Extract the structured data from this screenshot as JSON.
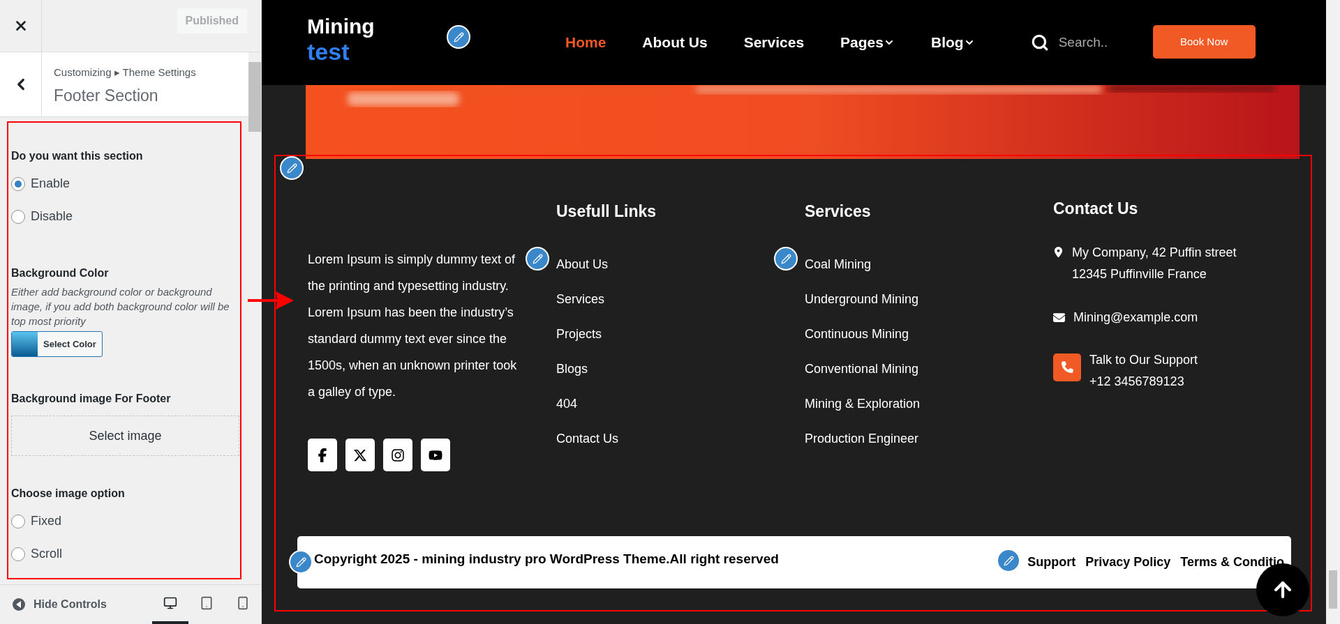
{
  "customizer": {
    "publish_button": "Published",
    "breadcrumb": "Customizing ▸ Theme Settings",
    "section_title": "Footer Section",
    "controls": [
      {
        "kind": "radio-group",
        "label": "Do you want this section",
        "options": [
          {
            "label": "Enable",
            "selected": true
          },
          {
            "label": "Disable",
            "selected": false
          }
        ]
      },
      {
        "kind": "color",
        "label": "Background Color",
        "description": "Either add background color or background image, if you add both background color will be top most priority",
        "button": "Select Color"
      },
      {
        "label": "Background image For Footer",
        "button": "Select image"
      },
      {
        "kind": "radio-group",
        "label": "Choose image option",
        "options": [
          {
            "label": "Fixed",
            "selected": false
          },
          {
            "label": "Scroll",
            "selected": false
          }
        ]
      }
    ],
    "hide_controls": "Hide Controls",
    "devices": [
      {
        "kind": "desktop",
        "selected": true
      },
      {
        "kind": "tablet",
        "selected": false
      },
      {
        "kind": "mobile",
        "selected": false
      }
    ]
  },
  "site": {
    "logo": {
      "line1": "Mining",
      "line2": "test"
    },
    "nav": [
      {
        "label": "Home",
        "selected": true,
        "dropdown": false
      },
      {
        "label": "About Us",
        "selected": false,
        "dropdown": false
      },
      {
        "label": "Services",
        "selected": false,
        "dropdown": false
      },
      {
        "label": "Pages",
        "selected": false,
        "dropdown": true
      },
      {
        "label": "Blog",
        "selected": false,
        "dropdown": true
      }
    ],
    "search_placeholder": "Search..",
    "book_button": "Book Now",
    "footer": {
      "about": "Lorem Ipsum is simply dummy text of the printing and typesetting industry. Lorem Ipsum has been the industry’s standard dummy text ever since the 1500s, when an unknown printer took a galley of type.",
      "columns": [
        {
          "title": "Usefull Links",
          "links": [
            "About Us",
            "Services",
            "Projects",
            "Blogs",
            "404",
            "Contact Us"
          ]
        },
        {
          "title": "Services",
          "links": [
            "Coal Mining",
            "Underground Mining",
            "Continuous Mining",
            "Conventional Mining",
            "Mining & Exploration",
            "Production Engineer"
          ]
        }
      ],
      "contact": {
        "title": "Contact Us",
        "items": [
          {
            "kind": "address",
            "lines": [
              "My Company, 42 Puffin street",
              "12345 Puffinville France"
            ]
          },
          {
            "kind": "email",
            "lines": [
              "Mining@example.com"
            ]
          },
          {
            "kind": "phone",
            "lines": [
              "Talk to Our Support",
              "+12 3456789123"
            ]
          }
        ]
      },
      "social": [
        {
          "kind": "facebook"
        },
        {
          "kind": "x"
        },
        {
          "kind": "instagram"
        },
        {
          "kind": "youtube"
        }
      ],
      "copyright": "Copyright 2025 - mining industry pro WordPress Theme.All right reserved",
      "bottom_links": [
        "Support",
        "Privacy Policy",
        "Terms & Conditio"
      ]
    }
  }
}
